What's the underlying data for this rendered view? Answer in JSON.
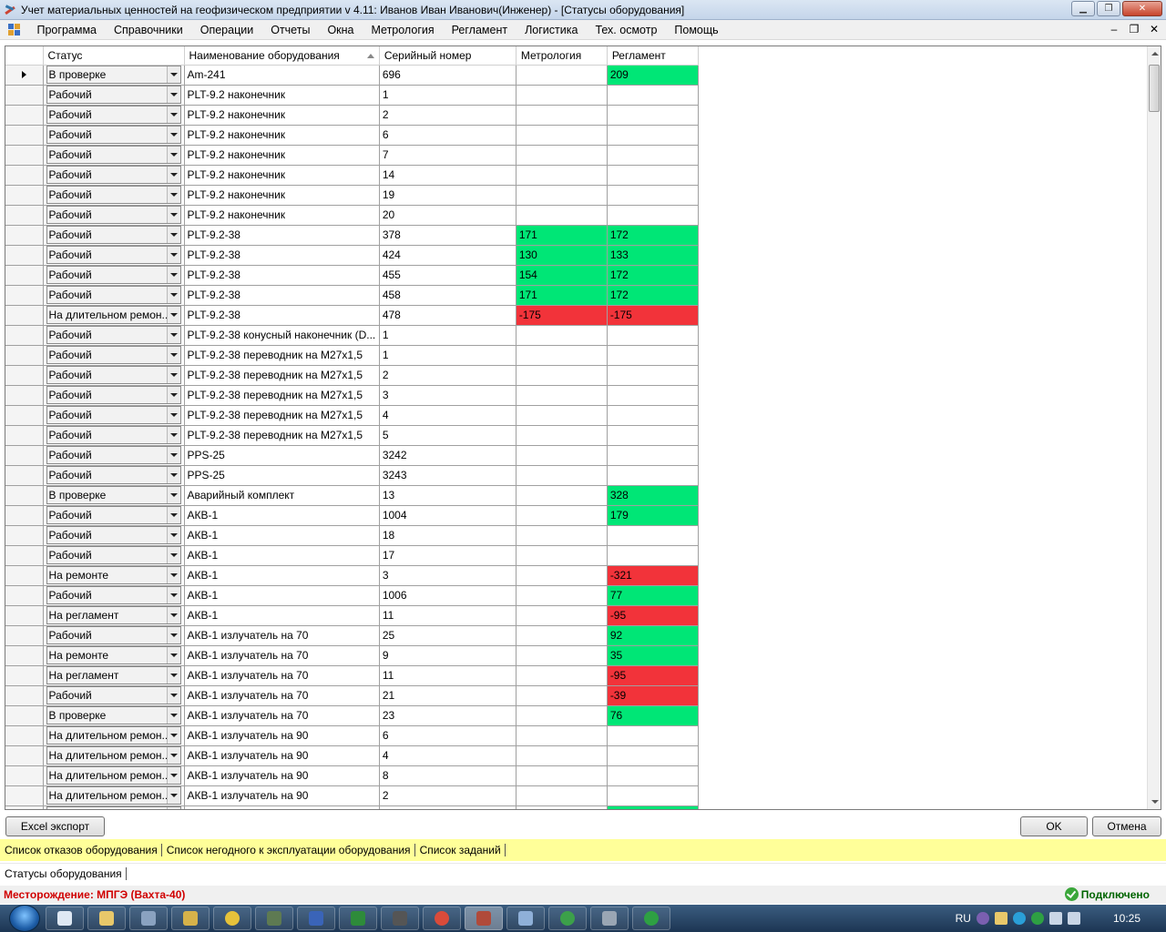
{
  "window": {
    "title": "Учет материальных ценностей на геофизическом предприятии v 4.11: Иванов Иван Иванович(Инженер) - [Статусы оборудования]",
    "minimize": "▁",
    "maximize": "❐",
    "close": "✕"
  },
  "menu": {
    "items": [
      "Программа",
      "Справочники",
      "Операции",
      "Отчеты",
      "Окна",
      "Метрология",
      "Регламент",
      "Логистика",
      "Тех. осмотр",
      "Помощь"
    ],
    "mdi_minimize": "–",
    "mdi_restore": "❐",
    "mdi_close": "✕"
  },
  "grid": {
    "columns": [
      "Статус",
      "Наименование оборудования",
      "Серийный номер",
      "Метрология",
      "Регламент"
    ],
    "sorted_column": "Наименование оборудования",
    "rows": [
      {
        "status": "В проверке",
        "name": "Am-241",
        "serial": "696",
        "metro": "",
        "metro_color": "",
        "regl": "209",
        "regl_color": "green",
        "current": true
      },
      {
        "status": "Рабочий",
        "name": "PLT-9.2 наконечник",
        "serial": "1",
        "metro": "",
        "metro_color": "",
        "regl": "",
        "regl_color": ""
      },
      {
        "status": "Рабочий",
        "name": "PLT-9.2 наконечник",
        "serial": "2",
        "metro": "",
        "metro_color": "",
        "regl": "",
        "regl_color": ""
      },
      {
        "status": "Рабочий",
        "name": "PLT-9.2 наконечник",
        "serial": "6",
        "metro": "",
        "metro_color": "",
        "regl": "",
        "regl_color": ""
      },
      {
        "status": "Рабочий",
        "name": "PLT-9.2 наконечник",
        "serial": "7",
        "metro": "",
        "metro_color": "",
        "regl": "",
        "regl_color": ""
      },
      {
        "status": "Рабочий",
        "name": "PLT-9.2 наконечник",
        "serial": "14",
        "metro": "",
        "metro_color": "",
        "regl": "",
        "regl_color": ""
      },
      {
        "status": "Рабочий",
        "name": "PLT-9.2 наконечник",
        "serial": "19",
        "metro": "",
        "metro_color": "",
        "regl": "",
        "regl_color": ""
      },
      {
        "status": "Рабочий",
        "name": "PLT-9.2 наконечник",
        "serial": "20",
        "metro": "",
        "metro_color": "",
        "regl": "",
        "regl_color": ""
      },
      {
        "status": "Рабочий",
        "name": "PLT-9.2-38",
        "serial": "378",
        "metro": "171",
        "metro_color": "green",
        "regl": "172",
        "regl_color": "green"
      },
      {
        "status": "Рабочий",
        "name": "PLT-9.2-38",
        "serial": "424",
        "metro": "130",
        "metro_color": "green",
        "regl": "133",
        "regl_color": "green"
      },
      {
        "status": "Рабочий",
        "name": "PLT-9.2-38",
        "serial": "455",
        "metro": "154",
        "metro_color": "green",
        "regl": "172",
        "regl_color": "green"
      },
      {
        "status": "Рабочий",
        "name": "PLT-9.2-38",
        "serial": "458",
        "metro": "171",
        "metro_color": "green",
        "regl": "172",
        "regl_color": "green"
      },
      {
        "status": "На длительном ремон...",
        "name": "PLT-9.2-38",
        "serial": "478",
        "metro": "-175",
        "metro_color": "red",
        "regl": "-175",
        "regl_color": "red"
      },
      {
        "status": "Рабочий",
        "name": "PLT-9.2-38 конусный наконечник (D...",
        "serial": "1",
        "metro": "",
        "metro_color": "",
        "regl": "",
        "regl_color": ""
      },
      {
        "status": "Рабочий",
        "name": "PLT-9.2-38 переводник на М27х1,5",
        "serial": "1",
        "metro": "",
        "metro_color": "",
        "regl": "",
        "regl_color": ""
      },
      {
        "status": "Рабочий",
        "name": "PLT-9.2-38 переводник на М27х1,5",
        "serial": "2",
        "metro": "",
        "metro_color": "",
        "regl": "",
        "regl_color": ""
      },
      {
        "status": "Рабочий",
        "name": "PLT-9.2-38 переводник на М27х1,5",
        "serial": "3",
        "metro": "",
        "metro_color": "",
        "regl": "",
        "regl_color": ""
      },
      {
        "status": "Рабочий",
        "name": "PLT-9.2-38 переводник на М27х1,5",
        "serial": "4",
        "metro": "",
        "metro_color": "",
        "regl": "",
        "regl_color": ""
      },
      {
        "status": "Рабочий",
        "name": "PLT-9.2-38 переводник на М27х1,5",
        "serial": "5",
        "metro": "",
        "metro_color": "",
        "regl": "",
        "regl_color": ""
      },
      {
        "status": "Рабочий",
        "name": "PPS-25",
        "serial": "3242",
        "metro": "",
        "metro_color": "",
        "regl": "",
        "regl_color": ""
      },
      {
        "status": "Рабочий",
        "name": "PPS-25",
        "serial": "3243",
        "metro": "",
        "metro_color": "",
        "regl": "",
        "regl_color": ""
      },
      {
        "status": "В проверке",
        "name": "Аварийный комплект",
        "serial": "13",
        "metro": "",
        "metro_color": "",
        "regl": "328",
        "regl_color": "green"
      },
      {
        "status": "Рабочий",
        "name": "АКВ-1",
        "serial": "1004",
        "metro": "",
        "metro_color": "",
        "regl": "179",
        "regl_color": "green"
      },
      {
        "status": "Рабочий",
        "name": "АКВ-1",
        "serial": "18",
        "metro": "",
        "metro_color": "",
        "regl": "",
        "regl_color": ""
      },
      {
        "status": "Рабочий",
        "name": "АКВ-1",
        "serial": "17",
        "metro": "",
        "metro_color": "",
        "regl": "",
        "regl_color": ""
      },
      {
        "status": "На ремонте",
        "name": "АКВ-1",
        "serial": "3",
        "metro": "",
        "metro_color": "",
        "regl": "-321",
        "regl_color": "red"
      },
      {
        "status": "Рабочий",
        "name": "АКВ-1",
        "serial": "1006",
        "metro": "",
        "metro_color": "",
        "regl": "77",
        "regl_color": "green"
      },
      {
        "status": "На регламент",
        "name": "АКВ-1",
        "serial": "11",
        "metro": "",
        "metro_color": "",
        "regl": "-95",
        "regl_color": "red"
      },
      {
        "status": "Рабочий",
        "name": "АКВ-1 излучатель на  70",
        "serial": "25",
        "metro": "",
        "metro_color": "",
        "regl": "92",
        "regl_color": "green"
      },
      {
        "status": "На ремонте",
        "name": "АКВ-1 излучатель на  70",
        "serial": "9",
        "metro": "",
        "metro_color": "",
        "regl": "35",
        "regl_color": "green"
      },
      {
        "status": "На регламент",
        "name": "АКВ-1 излучатель на  70",
        "serial": "11",
        "metro": "",
        "metro_color": "",
        "regl": "-95",
        "regl_color": "red"
      },
      {
        "status": "Рабочий",
        "name": "АКВ-1 излучатель на  70",
        "serial": "21",
        "metro": "",
        "metro_color": "",
        "regl": "-39",
        "regl_color": "red"
      },
      {
        "status": "В проверке",
        "name": "АКВ-1 излучатель на  70",
        "serial": "23",
        "metro": "",
        "metro_color": "",
        "regl": "76",
        "regl_color": "green"
      },
      {
        "status": "На длительном ремон...",
        "name": "АКВ-1 излучатель на  90",
        "serial": "6",
        "metro": "",
        "metro_color": "",
        "regl": "",
        "regl_color": ""
      },
      {
        "status": "На длительном ремон...",
        "name": "АКВ-1 излучатель на  90",
        "serial": "4",
        "metro": "",
        "metro_color": "",
        "regl": "",
        "regl_color": ""
      },
      {
        "status": "На длительном ремон...",
        "name": "АКВ-1 излучатель на  90",
        "serial": "8",
        "metro": "",
        "metro_color": "",
        "regl": "",
        "regl_color": ""
      },
      {
        "status": "На длительном ремон...",
        "name": "АКВ-1 излучатель на  90",
        "serial": "2",
        "metro": "",
        "metro_color": "",
        "regl": "",
        "regl_color": ""
      },
      {
        "status": "",
        "name": "",
        "serial": "",
        "metro": "",
        "metro_color": "",
        "regl": "",
        "regl_color": "green"
      }
    ]
  },
  "buttons": {
    "excel": "Excel экспорт",
    "ok": "OK",
    "cancel": "Отмена"
  },
  "links": [
    "Список отказов оборудования",
    "Список негодного к эксплуатации оборудования",
    "Список заданий"
  ],
  "open_windows": [
    "Статусы оборудования"
  ],
  "status": {
    "deposit": "Месторождение: МПГЭ (Вахта-40)",
    "connection": "Подключено"
  },
  "taskbar": {
    "language": "RU",
    "time": "10:25"
  },
  "colors": {
    "green": "#00e676",
    "red": "#f2333a",
    "links_bar": "#ffff99",
    "deposit_text": "#d00000"
  }
}
